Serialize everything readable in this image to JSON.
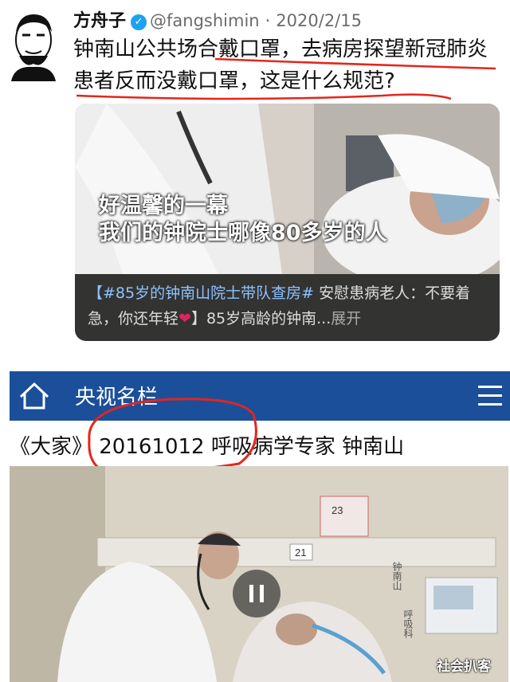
{
  "tweet": {
    "author_name": "方舟子",
    "handle": "@fangshimin",
    "separator": "·",
    "date": "2020/2/15",
    "text": "钟南山公共场合戴口罩，去病房探望新冠肺炎患者反而没戴口罩，这是什么规范?",
    "embedded_video": {
      "overlay_line1": "好温馨的一幕",
      "overlay_line2": "我们的钟院士哪像80多岁的人",
      "caption_hashtag": "【#85岁的钟南山院士带队查房#",
      "caption_rest": " 安慰患病老人：不要着急，你还年轻",
      "caption_tail": "】85岁高龄的钟南...",
      "expand_label": "展开"
    }
  },
  "cctv": {
    "title": "央视名栏",
    "program_title": "《大家》 20161012 呼吸病学专家 钟南山",
    "room_calendar": "23",
    "bed_number": "21",
    "side_label_1": "钟南山",
    "side_label_2": "呼吸科"
  },
  "watermark": "社会扒客",
  "colors": {
    "nav_blue": "#1b4f9a",
    "link_blue": "#8ec2ff",
    "verified": "#1da1f2",
    "annotation_red": "#e3261c"
  }
}
